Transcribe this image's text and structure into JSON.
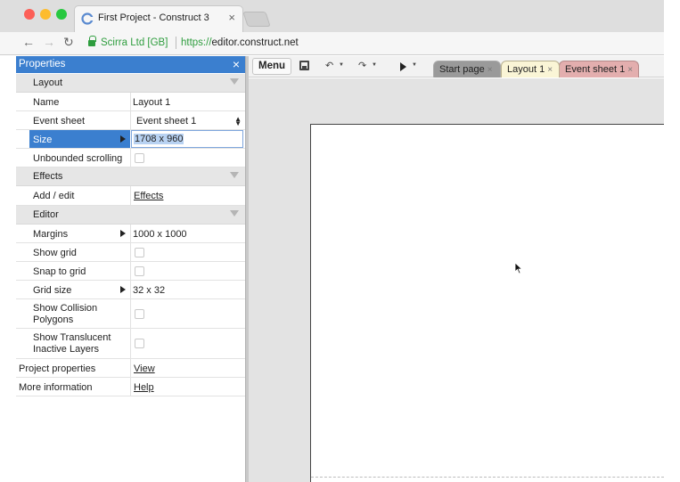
{
  "browser": {
    "tab_title": "First Project - Construct 3",
    "tab_close": "×",
    "site_identity": "Scirra Ltd [GB]",
    "url_scheme": "https://",
    "url_host": "editor.construct.net"
  },
  "properties": {
    "title": "Properties",
    "close": "×",
    "groups": {
      "layout": "Layout",
      "effects": "Effects",
      "editor": "Editor"
    },
    "rows": {
      "name": {
        "label": "Name",
        "value": "Layout 1"
      },
      "event_sheet": {
        "label": "Event sheet",
        "value": "Event sheet 1",
        "arrows": "▲▼"
      },
      "size": {
        "label": "Size",
        "value": "1708 x 960"
      },
      "unbounded_scrolling": {
        "label": "Unbounded scrolling",
        "checked": false
      },
      "add_edit": {
        "label": "Add / edit",
        "link": "Effects"
      },
      "margins": {
        "label": "Margins",
        "value": "1000 x 1000"
      },
      "show_grid": {
        "label": "Show grid",
        "checked": false
      },
      "snap_to_grid": {
        "label": "Snap to grid",
        "checked": false
      },
      "grid_size": {
        "label": "Grid size",
        "value": "32 x 32"
      },
      "show_collision": {
        "label_line1": "Show Collision",
        "label_line2": "Polygons",
        "checked": false
      },
      "show_translucent": {
        "label_line1": "Show Translucent",
        "label_line2": "Inactive Layers",
        "checked": false
      },
      "project_properties": {
        "label": "Project properties",
        "link": "View"
      },
      "more_information": {
        "label": "More information",
        "link": "Help"
      }
    }
  },
  "toolbar": {
    "menu_label": "Menu"
  },
  "editor_tabs": [
    {
      "label": "Start page",
      "close": "×"
    },
    {
      "label": "Layout 1",
      "close": "×"
    },
    {
      "label": "Event sheet 1",
      "close": "×"
    }
  ],
  "colors": {
    "accent": "#3b7fcf",
    "secure_green": "#2e9d3e",
    "layout_tab": "#faf5d6",
    "event_tab": "#e3aeae"
  },
  "icons": {
    "nav": [
      "back-arrow-icon",
      "forward-arrow-icon",
      "reload-icon"
    ],
    "toolbar": [
      "save-icon",
      "undo-icon",
      "redo-icon",
      "play-icon"
    ]
  }
}
